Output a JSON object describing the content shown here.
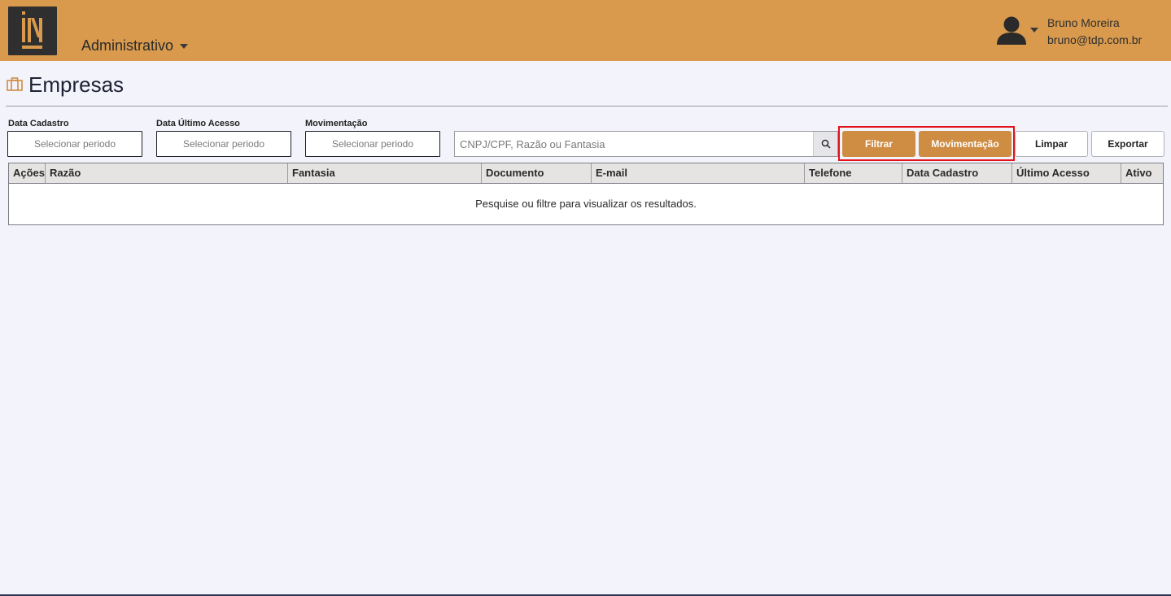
{
  "header": {
    "module_label": "Administrativo",
    "user_name": "Bruno Moreira",
    "user_email": "bruno@tdp.com.br",
    "bg_color": "#d99a4d"
  },
  "page": {
    "title": "Empresas"
  },
  "filters": {
    "data_cadastro": {
      "label": "Data Cadastro",
      "placeholder": "Selecionar periodo"
    },
    "data_ultimo_acesso": {
      "label": "Data Último Acesso",
      "placeholder": "Selecionar periodo"
    },
    "movimentacao": {
      "label": "Movimentação",
      "placeholder": "Selecionar periodo"
    },
    "search": {
      "placeholder": "CNPJ/CPF, Razão ou Fantasia",
      "value": ""
    }
  },
  "actions": {
    "filtrar": "Filtrar",
    "movimentacao": "Movimentação",
    "limpar": "Limpar",
    "exportar": "Exportar",
    "accent_color": "#cf8d44"
  },
  "table": {
    "columns": [
      "Ações",
      "Razão",
      "Fantasia",
      "Documento",
      "E-mail",
      "Telefone",
      "Data Cadastro",
      "Último Acesso",
      "Ativo"
    ],
    "empty_message": "Pesquise ou filtre para visualizar os resultados."
  }
}
